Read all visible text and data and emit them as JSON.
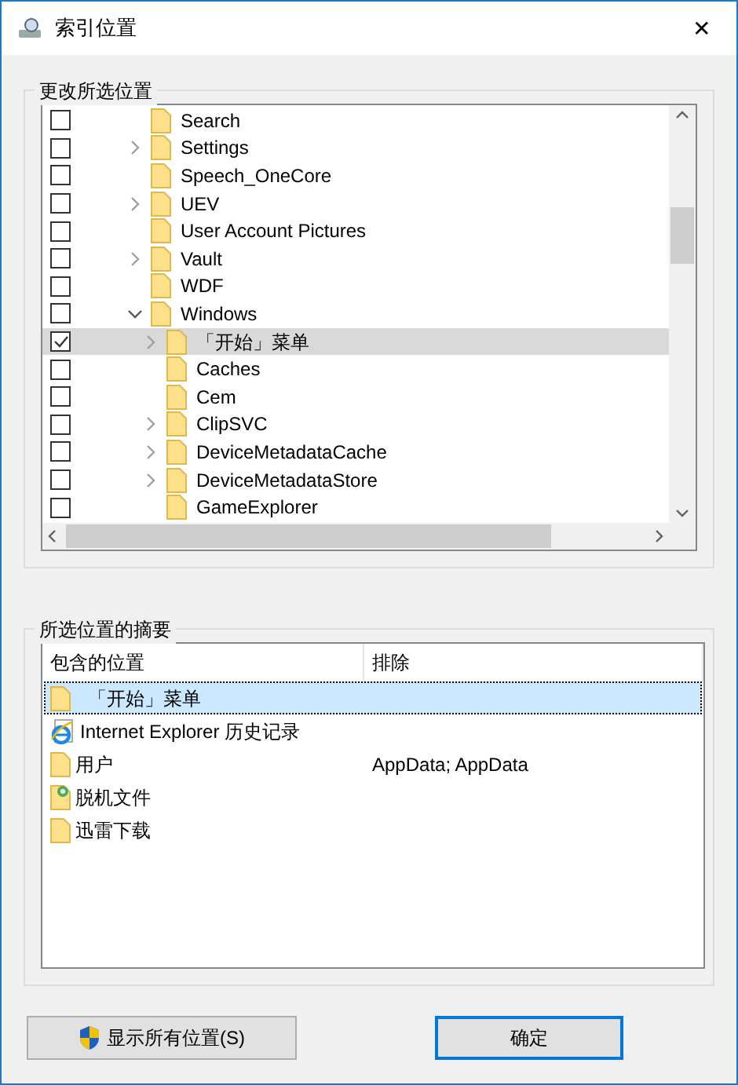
{
  "window": {
    "title": "索引位置",
    "close": "✕"
  },
  "change_group": {
    "title": "更改所选位置",
    "tree": [
      {
        "label": "Search",
        "checked": false,
        "expandable": false,
        "selected": false
      },
      {
        "label": "Settings",
        "checked": false,
        "expandable": true,
        "expanded": false,
        "selected": false
      },
      {
        "label": "Speech_OneCore",
        "checked": false,
        "expandable": false,
        "selected": false
      },
      {
        "label": "UEV",
        "checked": false,
        "expandable": true,
        "expanded": false,
        "selected": false
      },
      {
        "label": "User Account Pictures",
        "checked": false,
        "expandable": false,
        "selected": false
      },
      {
        "label": "Vault",
        "checked": false,
        "expandable": true,
        "expanded": false,
        "selected": false
      },
      {
        "label": "WDF",
        "checked": false,
        "expandable": false,
        "selected": false
      },
      {
        "label": "Windows",
        "checked": false,
        "expandable": true,
        "expanded": true,
        "selected": false,
        "children": [
          {
            "label": "「开始」菜单",
            "checked": true,
            "expandable": true,
            "expanded": false,
            "selected": true
          },
          {
            "label": "Caches",
            "checked": false,
            "expandable": false,
            "selected": false
          },
          {
            "label": "Cem",
            "checked": false,
            "expandable": false,
            "selected": false
          },
          {
            "label": "ClipSVC",
            "checked": false,
            "expandable": true,
            "expanded": false,
            "selected": false
          },
          {
            "label": "DeviceMetadataCache",
            "checked": false,
            "expandable": true,
            "expanded": false,
            "selected": false
          },
          {
            "label": "DeviceMetadataStore",
            "checked": false,
            "expandable": true,
            "expanded": false,
            "selected": false
          },
          {
            "label": "GameExplorer",
            "checked": false,
            "expandable": false,
            "selected": false
          }
        ]
      }
    ]
  },
  "summary_group": {
    "title": "所选位置的摘要",
    "columns": [
      "包含的位置",
      "排除"
    ],
    "rows": [
      {
        "kind": "folder",
        "location": "「开始」菜单",
        "selected": true
      },
      {
        "kind": "ie",
        "location": "Internet Explorer 历史记录",
        "selected": false
      },
      {
        "kind": "folder",
        "location": "用户",
        "exclude": "AppData; AppData",
        "selected": false
      },
      {
        "kind": "offline",
        "location": "脱机文件",
        "selected": false
      },
      {
        "kind": "folder",
        "location": "迅雷下载",
        "selected": false
      }
    ]
  },
  "buttons": [
    {
      "kind": "shield",
      "label": "显示所有位置(S)",
      "default": false
    },
    {
      "kind": "plain",
      "label": "确定",
      "default": true
    }
  ]
}
